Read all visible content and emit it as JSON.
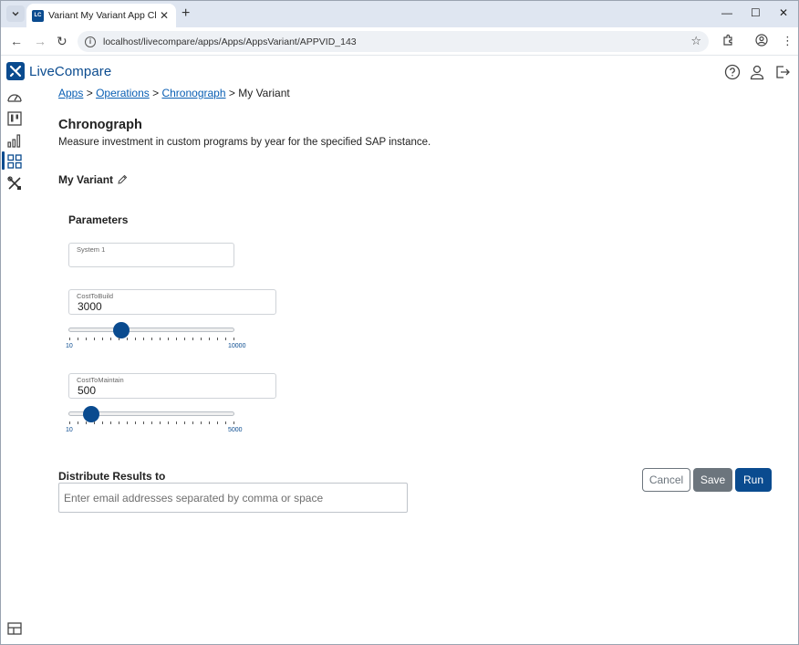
{
  "browser": {
    "tab_icon_text": "LC",
    "tab_title": "Variant My Variant App Chronograph",
    "url": "localhost/livecompare/apps/Apps/AppsVariant/APPVID_143"
  },
  "app": {
    "logo_text": "LiveCompare",
    "brand_color": "#0a4b8f"
  },
  "breadcrumb": {
    "items": [
      "Apps",
      "Operations",
      "Chronograph"
    ],
    "sep": ">",
    "current": "My Variant"
  },
  "page": {
    "title": "Chronograph",
    "description": "Measure investment in custom programs by year for the specified SAP instance."
  },
  "variant": {
    "name": "My Variant"
  },
  "parameters": {
    "title": "Parameters",
    "system1": {
      "label": "System 1",
      "value": ""
    },
    "cost_to_build": {
      "label": "CostToBuild",
      "value": "3000",
      "min": "10",
      "max": "10000",
      "fraction": 0.3
    },
    "cost_to_maintain": {
      "label": "CostToMaintain",
      "value": "500",
      "min": "10",
      "max": "5000",
      "fraction": 0.1
    }
  },
  "distribute": {
    "label": "Distribute Results to",
    "placeholder": "Enter email addresses separated by comma or space"
  },
  "buttons": {
    "cancel": "Cancel",
    "save": "Save",
    "run": "Run"
  }
}
